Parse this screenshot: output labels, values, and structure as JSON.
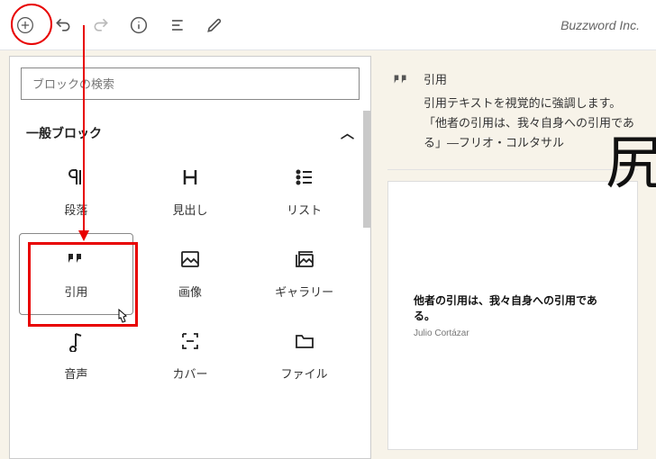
{
  "brand": "Buzzword Inc.",
  "search_placeholder": "ブロックの検索",
  "section": {
    "title": "一般ブロック"
  },
  "blocks": [
    {
      "label": "段落"
    },
    {
      "label": "見出し"
    },
    {
      "label": "リスト"
    },
    {
      "label": "引用"
    },
    {
      "label": "画像"
    },
    {
      "label": "ギャラリー"
    },
    {
      "label": "音声"
    },
    {
      "label": "カバー"
    },
    {
      "label": "ファイル"
    }
  ],
  "preview": {
    "title": "引用",
    "desc": "引用テキストを視覚的に強調します。「他者の引用は、我々自身への引用である」—フリオ・コルタサル",
    "quote_text": "他者の引用は、我々自身への引用である。",
    "quote_cite": "Julio Cortázar"
  }
}
